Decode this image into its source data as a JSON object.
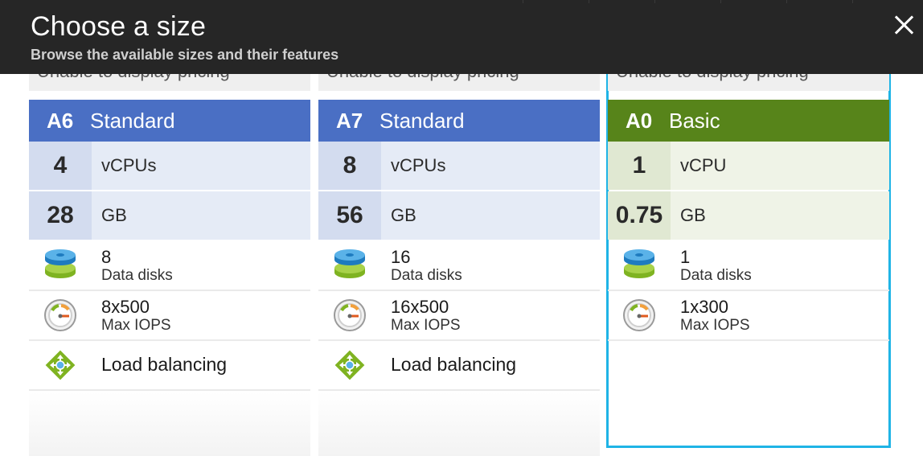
{
  "dialog": {
    "title": "Choose a size",
    "subtitle": "Browse the available sizes and their features"
  },
  "colors": {
    "header_bg": "#262626",
    "standard_tier": "#4a6fc4",
    "basic_tier": "#57841a",
    "selected_outline": "#1fb4e6"
  },
  "cards": [
    {
      "pricing": "Unable to display pricing",
      "code": "A6",
      "tier": "Standard",
      "cpu_value": "4",
      "cpu_unit": "vCPUs",
      "ram_value": "28",
      "ram_unit": "GB",
      "disks_value": "8",
      "disks_label": "Data disks",
      "iops_value": "8x500",
      "iops_label": "Max IOPS",
      "lb_label": "Load balancing",
      "selected": false
    },
    {
      "pricing": "Unable to display pricing",
      "code": "A7",
      "tier": "Standard",
      "cpu_value": "8",
      "cpu_unit": "vCPUs",
      "ram_value": "56",
      "ram_unit": "GB",
      "disks_value": "16",
      "disks_label": "Data disks",
      "iops_value": "16x500",
      "iops_label": "Max IOPS",
      "lb_label": "Load balancing",
      "selected": false
    },
    {
      "pricing": "Unable to display pricing",
      "code": "A0",
      "tier": "Basic",
      "cpu_value": "1",
      "cpu_unit": "vCPU",
      "ram_value": "0.75",
      "ram_unit": "GB",
      "disks_value": "1",
      "disks_label": "Data disks",
      "iops_value": "1x300",
      "iops_label": "Max IOPS",
      "selected": true
    }
  ],
  "icons": [
    "close-icon",
    "disk-stack-icon",
    "gauge-icon",
    "load-balancer-icon"
  ]
}
